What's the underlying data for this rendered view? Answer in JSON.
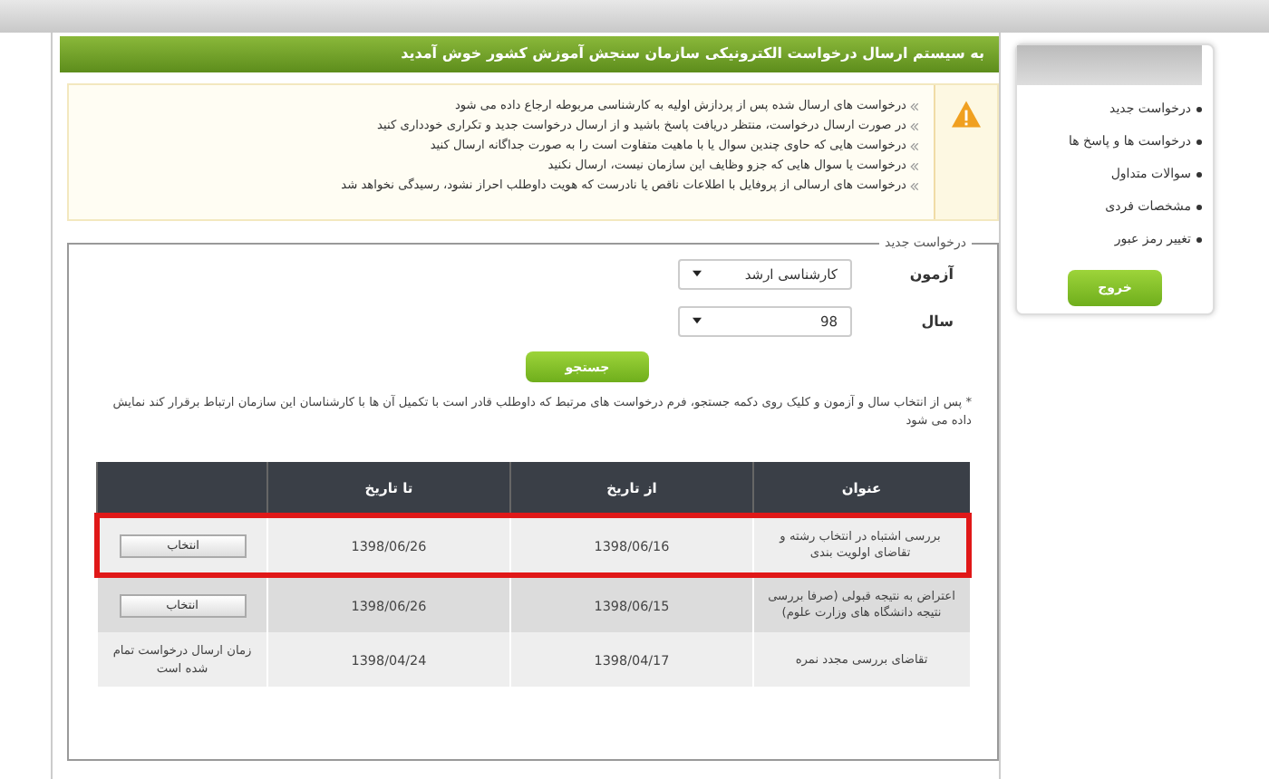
{
  "header": {
    "title": "به سیستم ارسال درخواست الکترونیکی سازمان سنجش آموزش کشور خوش آمدید"
  },
  "alert": {
    "lines": [
      "درخواست های ارسال شده پس از پردازش اولیه به کارشناسی مربوطه ارجاع داده می شود",
      "در صورت ارسال درخواست، منتظر دریافت پاسخ باشید و از ارسال درخواست جدید و تکراری خودداری کنید",
      "درخواست هایی که حاوی چندین سوال یا با ماهیت متفاوت است را به صورت جداگانه ارسال کنید",
      "درخواست یا سوال هایی که جزو وظایف این سازمان نیست، ارسال نکنید",
      "درخواست های ارسالی از پروفایل با اطلاعات ناقص یا نادرست که هویت داوطلب احراز نشود، رسیدگی نخواهد شد"
    ]
  },
  "form": {
    "legend": "درخواست جدید",
    "fields": [
      {
        "label": "آزمون",
        "value": "کارشناسی ارشد"
      },
      {
        "label": "سال",
        "value": "98"
      }
    ],
    "search_button": "جستجو",
    "note": "* پس از انتخاب سال و آزمون و کلیک روی دکمه جستجو، فرم درخواست های مرتبط که داوطلب قادر است با تکمیل آن ها با کارشناسان این سازمان ارتباط برقرار کند نمایش داده می شود"
  },
  "table": {
    "columns": [
      "عنوان",
      "از تاریخ",
      "تا تاریخ"
    ],
    "rows": [
      {
        "title": "بررسی اشتباه در انتخاب رشته و تقاضای اولویت بندی",
        "from": "1398/06/16",
        "to": "1398/06/26",
        "kind": "button",
        "action": "انتخاب",
        "highlighted": true
      },
      {
        "title": "اعتراض به نتیجه قبولی (صرفا بررسی نتیجه دانشگاه های وزارت علوم)",
        "from": "1398/06/15",
        "to": "1398/06/26",
        "kind": "button",
        "action": "انتخاب",
        "highlighted": false
      },
      {
        "title": "تقاضای بررسی مجدد نمره",
        "from": "1398/04/17",
        "to": "1398/04/24",
        "kind": "text",
        "action": "زمان ارسال درخواست تمام شده است",
        "highlighted": false
      }
    ]
  },
  "sidebar": {
    "items": [
      "درخواست جدید",
      "درخواست ها و پاسخ ها",
      "سوالات متداول",
      "مشخصات فردی",
      "تغییر رمز عبور"
    ],
    "logout": "خروج"
  }
}
